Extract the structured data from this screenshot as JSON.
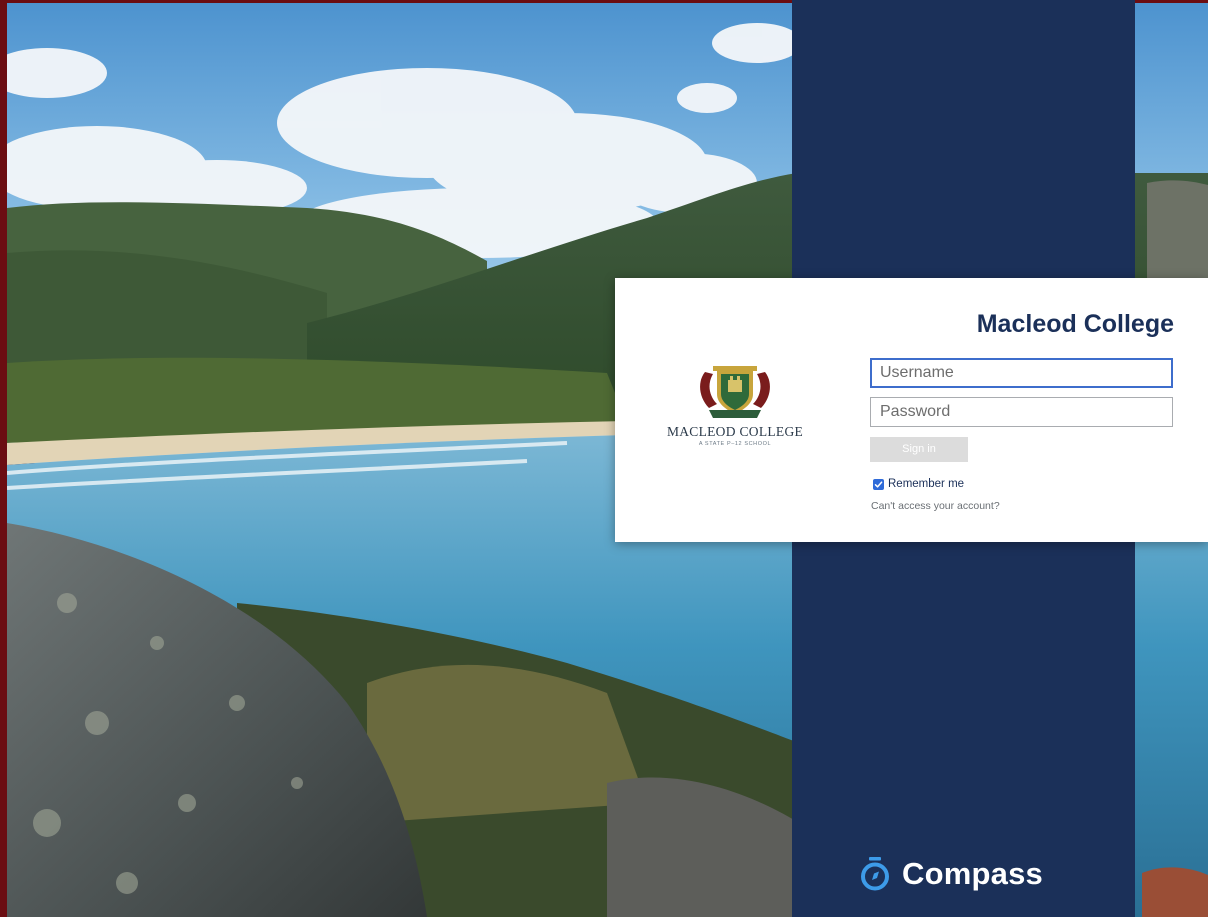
{
  "card": {
    "title": "Macleod College",
    "logo_name": "MACLEOD COLLEGE",
    "logo_subtitle": "A STATE P–12 SCHOOL",
    "username_placeholder": "Username",
    "password_placeholder": "Password",
    "signin_label": "Sign in",
    "remember_label": "Remember me",
    "remember_checked": true,
    "forgot_link": "Can't access your account?"
  },
  "brand": {
    "name": "Compass",
    "icon": "compass-stopwatch-icon"
  },
  "colors": {
    "navy": "#1b3059",
    "frame": "#6b0d12",
    "focus_border": "#3e6dcc",
    "checkbox": "#2f6bd9",
    "compass_accent": "#3d9be9"
  }
}
